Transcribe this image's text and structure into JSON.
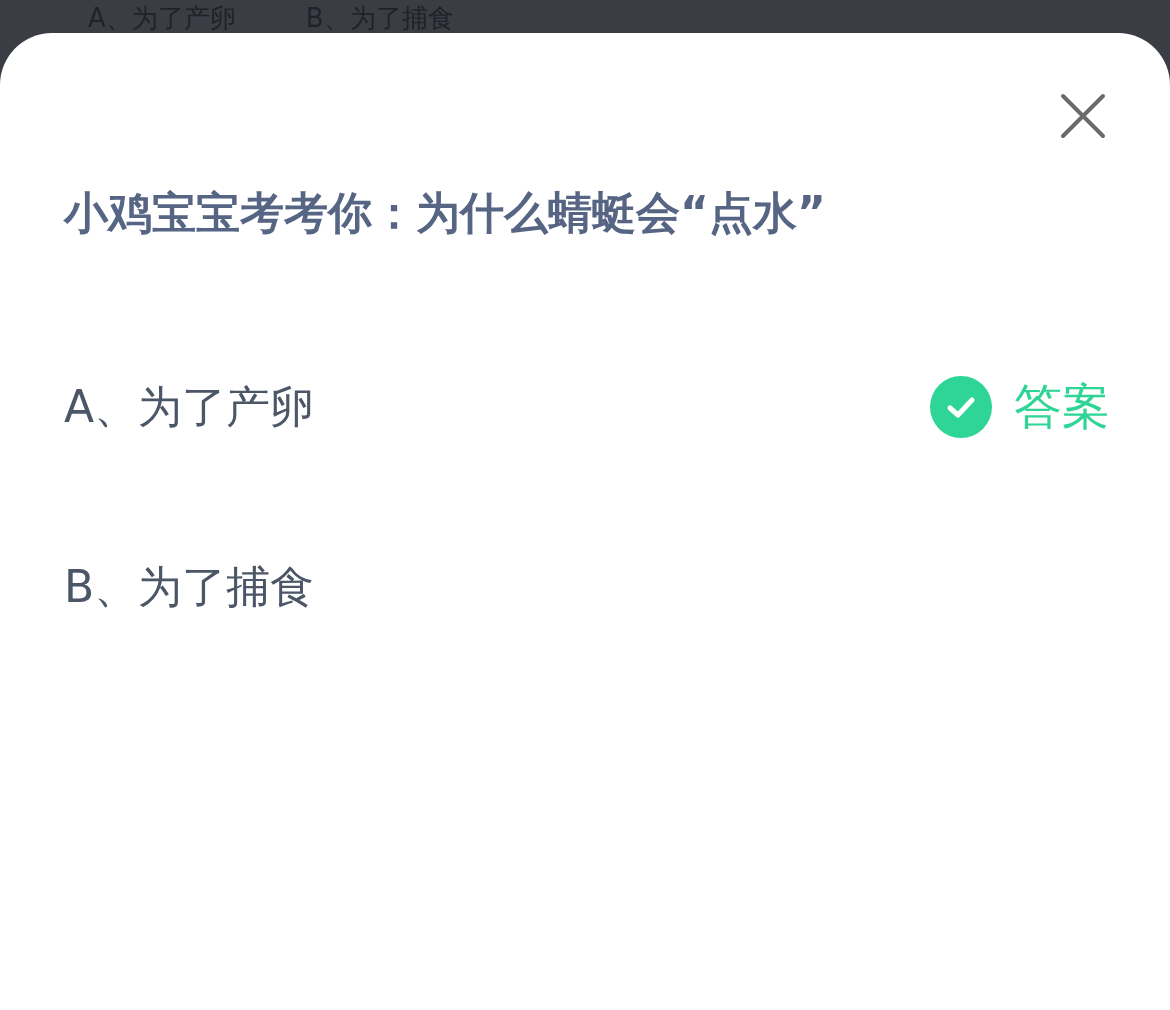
{
  "background_options": [
    "A、为了产卵",
    "B、为了捕食"
  ],
  "sheet": {
    "title": "小鸡宝宝考考你：为什么蜻蜓会“点水”",
    "options": [
      {
        "label": "A、为了产卵",
        "correct": true,
        "badge": "答案"
      },
      {
        "label": "B、为了捕食",
        "correct": false
      }
    ]
  }
}
